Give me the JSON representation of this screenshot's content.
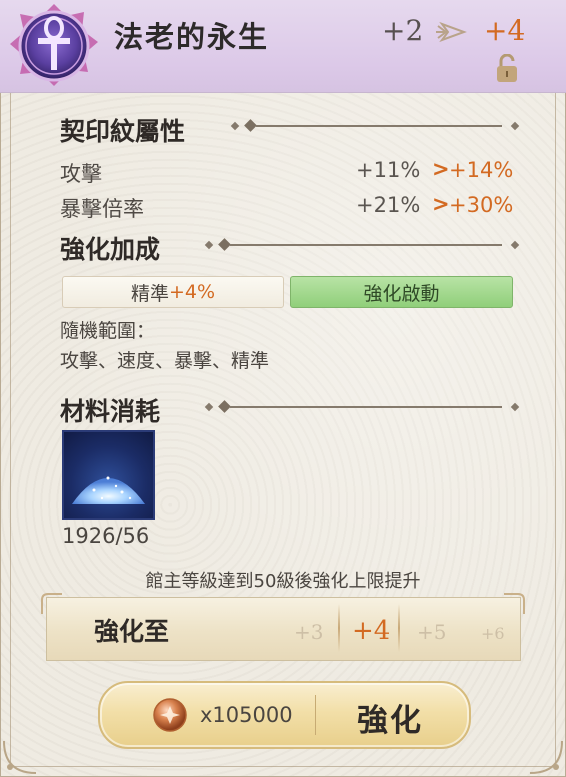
{
  "header": {
    "title": "法老的永生",
    "current_level": "+2",
    "next_level": "+4",
    "emblem_icon": "ankh-icon",
    "lock_icon": "lock-open-icon"
  },
  "attributes": {
    "title": "契印紋屬性",
    "stats": [
      {
        "name": "攻擊",
        "current": "+11%",
        "arrow": ">",
        "next": "+14%"
      },
      {
        "name": "暴擊倍率",
        "current": "+21%",
        "arrow": ">",
        "next": "+30%"
      }
    ]
  },
  "bonus": {
    "title": "強化加成",
    "left_label": "精準",
    "left_value": "+4%",
    "right_label": "強化啟動",
    "random_title": "隨機範圍：",
    "random_list": "攻擊、速度、暴擊、精準"
  },
  "materials": {
    "title": "材料消耗",
    "item_icon": "crystal-dust-icon",
    "count": "1926/56"
  },
  "notice": "館主等級達到50級後強化上限提升",
  "upgrade_to": {
    "label": "強化至",
    "options": [
      "+3",
      "+4",
      "+5",
      "+6"
    ],
    "selected": "+4"
  },
  "action": {
    "coin_icon": "coin-icon",
    "cost": "x105000",
    "button_label": "強化"
  },
  "colors": {
    "accent_orange": "#d36a22",
    "active_green": "#90cf7a",
    "header_purple": "#dcc9e8"
  }
}
